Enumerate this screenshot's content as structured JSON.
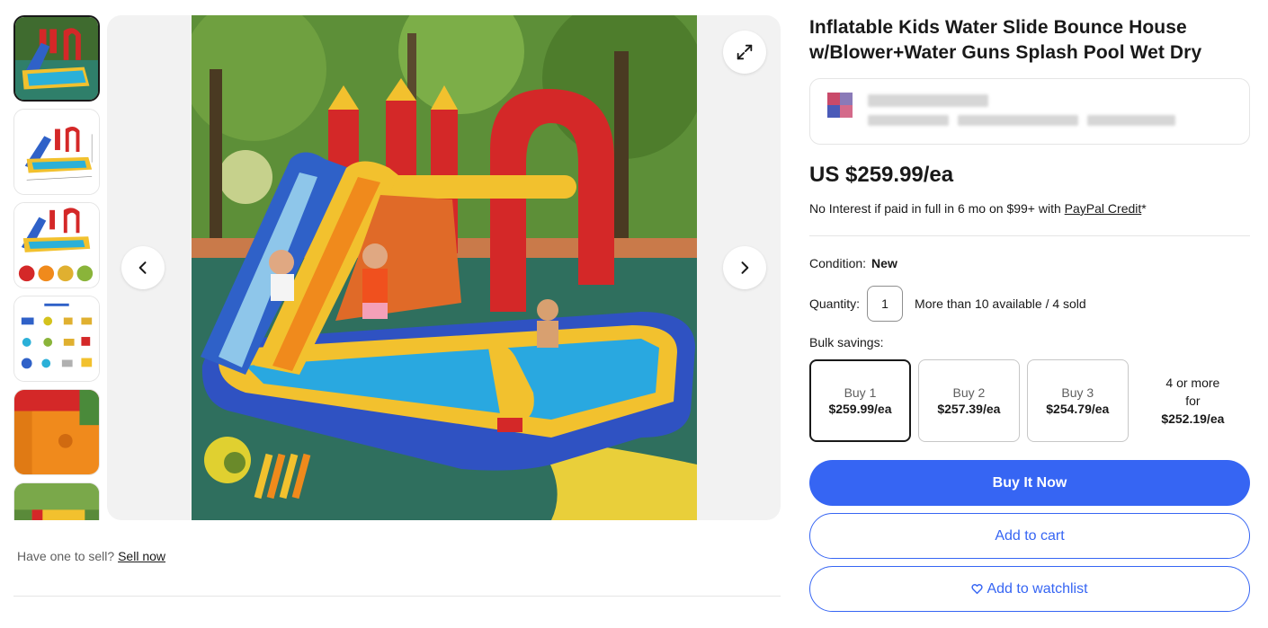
{
  "gallery": {
    "thumbnails": [
      {
        "icon": "product-photo-thumbnail",
        "selected": true
      },
      {
        "icon": "product-dimensions-thumbnail",
        "selected": false
      },
      {
        "icon": "product-accessories-thumbnail",
        "selected": false
      },
      {
        "icon": "parts-list-thumbnail",
        "selected": false
      },
      {
        "icon": "detail-closeup-thumbnail",
        "selected": false
      },
      {
        "icon": "outdoor-photo-thumbnail",
        "selected": false
      }
    ],
    "main_image_icon": "inflatable-water-slide-photo",
    "expand_icon": "expand-icon",
    "prev_icon": "chevron-left-icon",
    "next_icon": "chevron-right-icon"
  },
  "sell": {
    "prompt": "Have one to sell?",
    "link": "Sell now"
  },
  "listing": {
    "title": "Inflatable Kids Water Slide Bounce House w/Blower+Water Guns Splash Pool Wet Dry",
    "price": "US $259.99/ea",
    "financing_text": "No Interest if paid in full in 6 mo on $99+ with ",
    "financing_link": "PayPal Credit",
    "financing_suffix": "*",
    "condition_label": "Condition:",
    "condition_value": "New",
    "quantity_label": "Quantity:",
    "quantity_value": "1",
    "availability": "More than 10 available / 4 sold",
    "bulk_label": "Bulk savings:",
    "bulk_options": [
      {
        "qty": "Buy 1",
        "price": "$259.99/ea",
        "selected": true
      },
      {
        "qty": "Buy 2",
        "price": "$257.39/ea",
        "selected": false
      },
      {
        "qty": "Buy 3",
        "price": "$254.79/ea",
        "selected": false
      }
    ],
    "bulk_last_line1": "4 or more",
    "bulk_last_line2": "for",
    "bulk_last_price": "$252.19/ea",
    "buy_now": "Buy It Now",
    "add_to_cart": "Add to cart",
    "add_to_watchlist": "Add to watchlist"
  },
  "colors": {
    "primary": "#3665f3",
    "text": "#191919",
    "muted": "#5e5e5e",
    "border": "#e5e5e5"
  }
}
